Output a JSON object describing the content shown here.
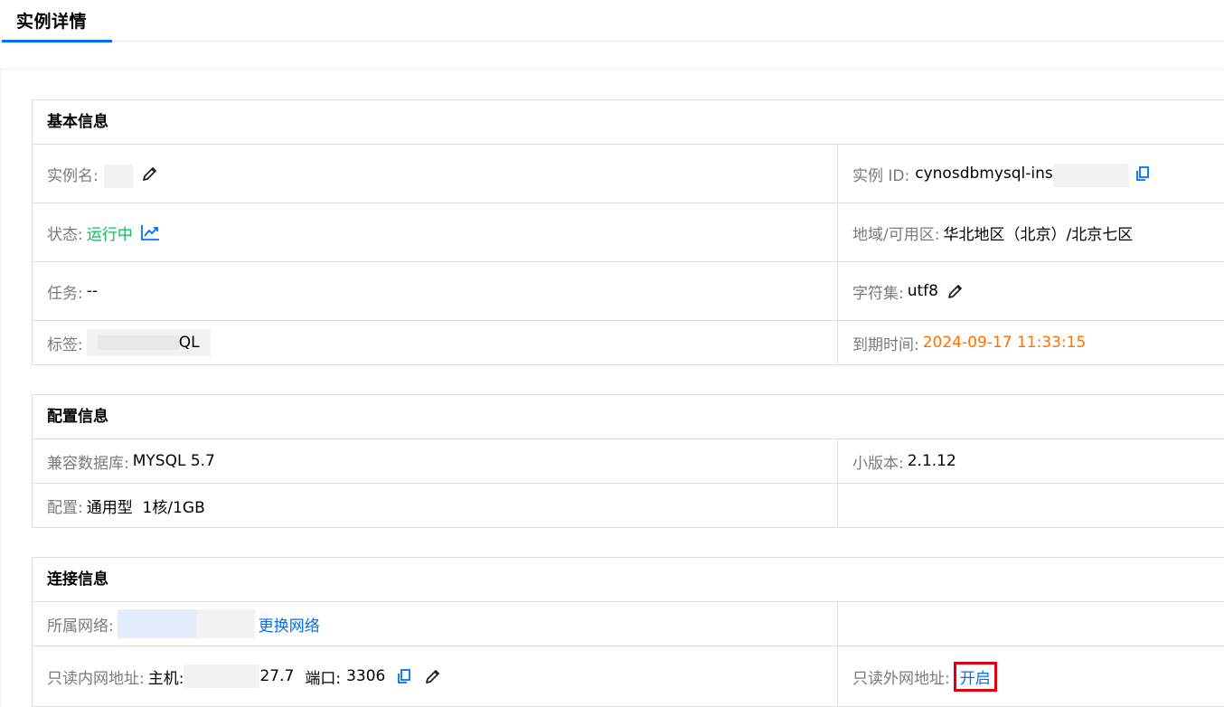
{
  "tab": {
    "label": "实例详情"
  },
  "basic": {
    "title": "基本信息",
    "name_label": "实例名:",
    "id_label": "实例 ID:",
    "id_value": "cynosdbmysql-ins",
    "status_label": "状态:",
    "status_value": "运行中",
    "region_label": "地域/可用区:",
    "region_value": "华北地区（北京）/北京七区",
    "task_label": "任务:",
    "task_value": "--",
    "charset_label": "字符集:",
    "charset_value": "utf8",
    "tag_label": "标签:",
    "tag_value_suffix": "QL",
    "expire_label": "到期时间:",
    "expire_value": "2024-09-17 11:33:15"
  },
  "config": {
    "title": "配置信息",
    "db_label": "兼容数据库:",
    "db_value": "MYSQL 5.7",
    "minor_label": "小版本:",
    "minor_value": "2.1.12",
    "spec_label": "配置:",
    "spec_value": "通用型  1核/1GB"
  },
  "connection": {
    "title": "连接信息",
    "network_label": "所属网络:",
    "network_change": "更换网络",
    "ro_internal_label": "只读内网地址:",
    "host_label": "主机:",
    "host_suffix": "27.7",
    "port_label": "端口:",
    "port_value": "3306",
    "ro_external_label": "只读外网地址:",
    "ro_external_action": "开启"
  },
  "colors": {
    "accent": "#006eff",
    "running": "#0abf5b",
    "expire": "#ff7200",
    "highlight": "#e0000f"
  }
}
